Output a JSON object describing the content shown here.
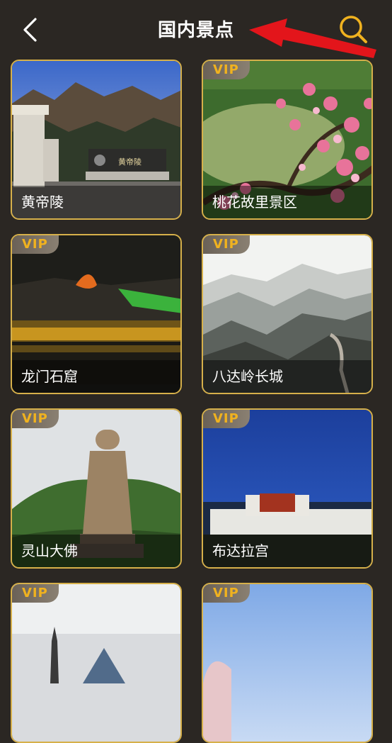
{
  "header": {
    "title": "国内景点",
    "accent": "#f0b21f"
  },
  "cards": [
    {
      "label": "黄帝陵",
      "vip": "",
      "scene": "mausoleum"
    },
    {
      "label": "桃花故里景区",
      "vip": "VIP",
      "scene": "peach-blossom"
    },
    {
      "label": "龙门石窟",
      "vip": "VIP",
      "scene": "night-grottoes"
    },
    {
      "label": "八达岭长城",
      "vip": "VIP",
      "scene": "great-wall"
    },
    {
      "label": "灵山大佛",
      "vip": "VIP",
      "scene": "buddha-statue"
    },
    {
      "label": "布达拉宫",
      "vip": "VIP",
      "scene": "potala-palace"
    },
    {
      "label": "",
      "vip": "VIP",
      "scene": "tower-pyramid"
    },
    {
      "label": "",
      "vip": "VIP",
      "scene": "sky"
    }
  ],
  "icons": {
    "back": "back-chevron-icon",
    "search": "search-icon",
    "annotation": "red-arrow-annotation"
  }
}
